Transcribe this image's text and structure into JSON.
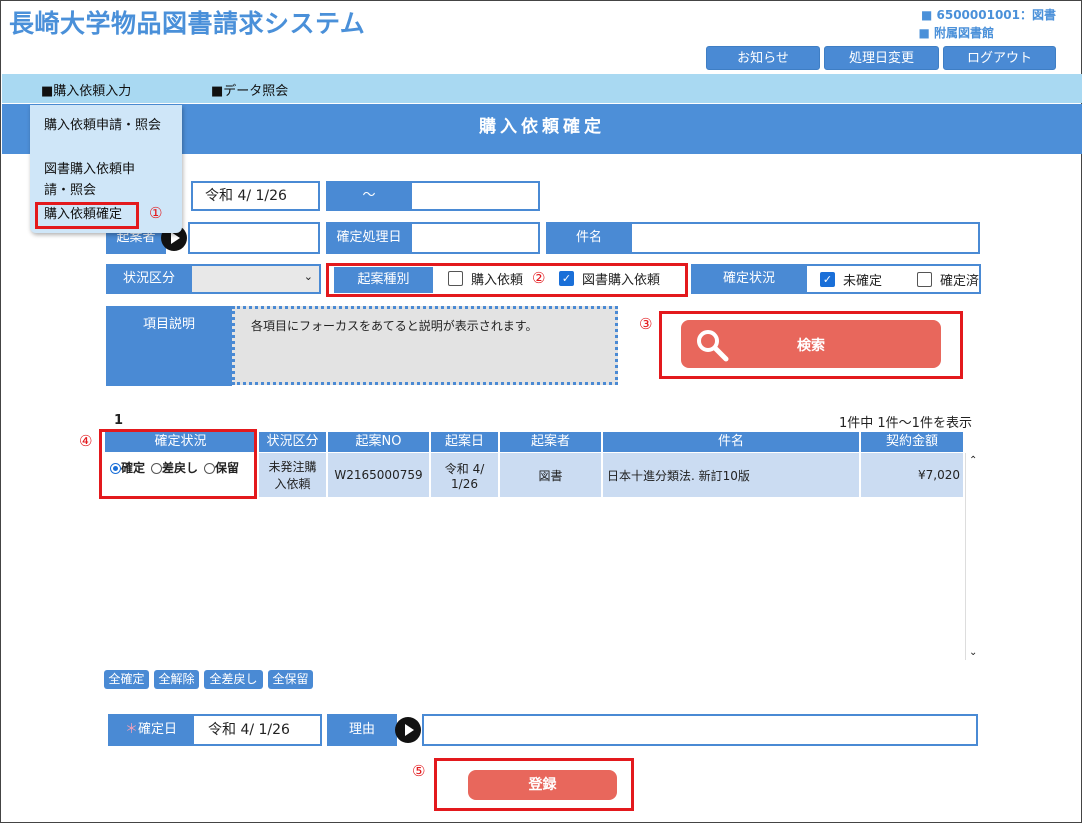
{
  "app": {
    "title": "長崎大学物品図書請求システム"
  },
  "user": {
    "code_line": "■ 6500001001：図書",
    "dept_line": "■ 附属図書館"
  },
  "header_buttons": {
    "notice": "お知らせ",
    "date_change": "処理日変更",
    "logout": "ログアウト"
  },
  "menu": {
    "purchase": "■購入依頼入力",
    "data": "■データ照会"
  },
  "dropdown": {
    "item1": "購入依頼申請・照会",
    "item2": "図書購入依頼申請・照会",
    "item3": "購入依頼確定"
  },
  "page": {
    "title": "購入依頼確定"
  },
  "search": {
    "date_from": "令和 4/ 1/26",
    "tilde": "～",
    "date_to": "",
    "drafter_label": "起案者",
    "confirm_date_label": "確定処理日",
    "subject_label": "件名",
    "status_label": "状況区分",
    "kind_label": "起案種別",
    "kind_opt1": "購入依頼",
    "kind_opt2": "図書購入依頼",
    "confirm_status_label": "確定状況",
    "status_opt1": "未確定",
    "status_opt2": "確定済",
    "help_label": "項目説明",
    "help_text": "各項目にフォーカスをあてると説明が表示されます。",
    "search_button": "検索"
  },
  "results": {
    "page": "1",
    "count_text": "1件中 1件～1件を表示",
    "headers": [
      "確定状況",
      "状況区分",
      "起案NO",
      "起案日",
      "起案者",
      "件名",
      "契約金額"
    ],
    "row": {
      "radio1": "確定",
      "radio2": "差戻し",
      "radio3": "保留",
      "status": "未発注購入依頼",
      "no": "W2165000759",
      "date": "令和 4/ 1/26",
      "drafter": "図書",
      "subject": "日本十進分類法. 新訂10版",
      "amount": "¥7,020"
    }
  },
  "bulk_buttons": {
    "all_confirm": "全確定",
    "all_release": "全解除",
    "all_return": "全差戻し",
    "all_hold": "全保留"
  },
  "confirm": {
    "required_mark": "＊",
    "date_label": "確定日",
    "date_value": "令和 4/ 1/26",
    "reason_label": "理由",
    "register_button": "登録"
  },
  "annotations": [
    "①",
    "②",
    "③",
    "④",
    "⑤"
  ],
  "colors": {
    "accent": "#4a8ad4",
    "annotation": "#e3191d",
    "action": "#e8675c"
  }
}
